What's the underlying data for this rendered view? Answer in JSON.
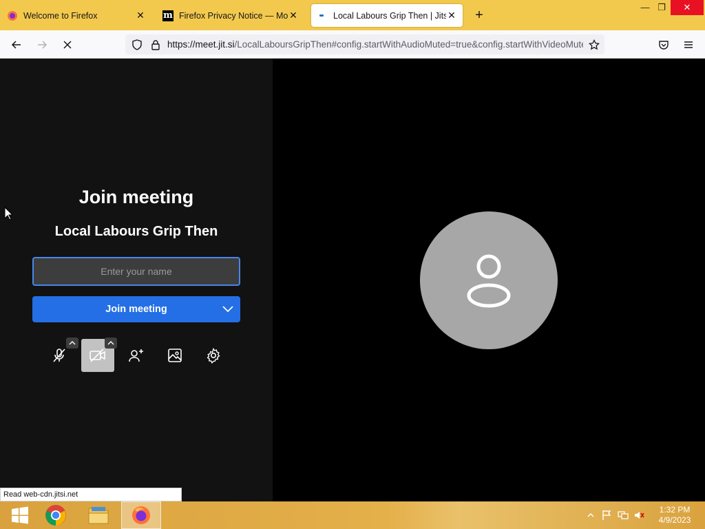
{
  "browser": {
    "tabs": [
      {
        "title": "Welcome to Firefox",
        "favicon": "firefox-icon"
      },
      {
        "title": "Firefox Privacy Notice — Mozilla",
        "favicon": "mozilla-m-icon"
      },
      {
        "title": "Local Labours Grip Then | Jitsi M",
        "favicon": "jitsi-icon"
      }
    ],
    "url_host": "https://meet.jit.si",
    "url_path": "/LocalLaboursGripThen#config.startWithAudioMuted=true&config.startWithVideoMuted=true",
    "status_text": "Read web-cdn.jitsi.net"
  },
  "prejoin": {
    "heading": "Join meeting",
    "room_name": "Local Labours Grip Then",
    "name_placeholder": "Enter your name",
    "join_label": "Join meeting"
  },
  "taskbar": {
    "time": "1:32 PM",
    "date": "4/9/2023"
  },
  "colors": {
    "tabbar": "#f3c94d",
    "join_button": "#246fe5",
    "input_border": "#4687ed",
    "avatar": "#a7a7a7"
  }
}
